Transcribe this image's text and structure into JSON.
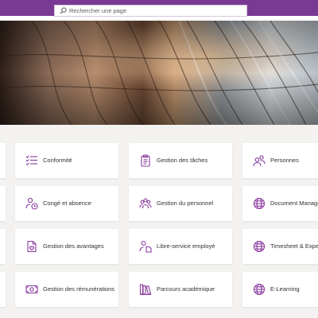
{
  "search": {
    "placeholder": "Rechercher une page"
  },
  "colors": {
    "suite_bar": "#7a3a94",
    "icon": "#8a3a9e",
    "background": "#f3f2f1"
  },
  "tiles": [
    {
      "label": "Conformité",
      "icon": "checklist-icon"
    },
    {
      "label": "Gestion des tâches",
      "icon": "clipboard-icon"
    },
    {
      "label": "Personnes",
      "icon": "people-icon"
    },
    {
      "label": "Congé et absence",
      "icon": "person-clock-icon"
    },
    {
      "label": "Gestion du personnel",
      "icon": "people-group-icon"
    },
    {
      "label": "Document Managem",
      "icon": "globe-icon"
    },
    {
      "label": "Gestion des avantages",
      "icon": "document-heart-icon"
    },
    {
      "label": "Libre-service employé",
      "icon": "person-document-icon"
    },
    {
      "label": "Timesheet & Expens",
      "icon": "globe-icon"
    },
    {
      "label": "Gestion des rémunérations",
      "icon": "money-icon"
    },
    {
      "label": "Parcours académique",
      "icon": "books-icon"
    },
    {
      "label": "E-Learning",
      "icon": "globe-icon"
    }
  ]
}
